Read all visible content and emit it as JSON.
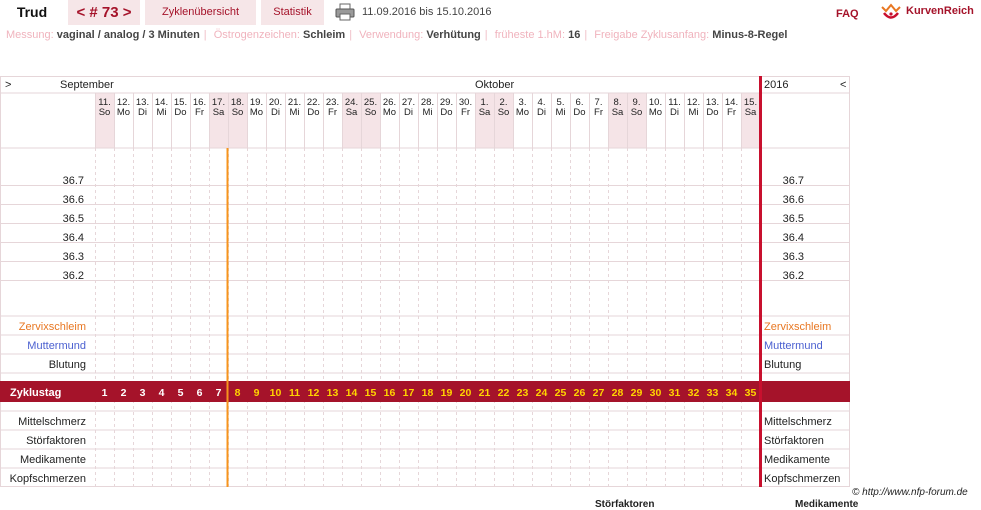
{
  "header": {
    "user": "Trud",
    "cycle_label": "< # 73 >",
    "tab_overview": "Zyklenübersicht",
    "tab_stats": "Statistik",
    "date_range": "11.09.2016 bis 15.10.2016",
    "faq": "FAQ",
    "logo": "KurvenReich"
  },
  "info": [
    {
      "key": "Messung:",
      "value": "vaginal / analog / 3 Minuten"
    },
    {
      "key": "Östrogenzeichen:",
      "value": "Schleim"
    },
    {
      "key": "Verwendung:",
      "value": "Verhütung"
    },
    {
      "key": "früheste 1.hM:",
      "value": "16"
    },
    {
      "key": "Freigabe Zyklusanfang:",
      "value": "Minus-8-Regel"
    }
  ],
  "chart_data": {
    "type": "table",
    "nav_prev": ">",
    "nav_next": "<",
    "year": "2016",
    "months": [
      {
        "label": "September",
        "start_index": 0
      },
      {
        "label": "Oktober",
        "start_index": 20
      }
    ],
    "days": [
      {
        "d": "11.",
        "w": "So"
      },
      {
        "d": "12.",
        "w": "Mo"
      },
      {
        "d": "13.",
        "w": "Di"
      },
      {
        "d": "14.",
        "w": "Mi"
      },
      {
        "d": "15.",
        "w": "Do"
      },
      {
        "d": "16.",
        "w": "Fr"
      },
      {
        "d": "17.",
        "w": "Sa"
      },
      {
        "d": "18.",
        "w": "So"
      },
      {
        "d": "19.",
        "w": "Mo"
      },
      {
        "d": "20.",
        "w": "Di"
      },
      {
        "d": "21.",
        "w": "Mi"
      },
      {
        "d": "22.",
        "w": "Do"
      },
      {
        "d": "23.",
        "w": "Fr"
      },
      {
        "d": "24.",
        "w": "Sa"
      },
      {
        "d": "25.",
        "w": "So"
      },
      {
        "d": "26.",
        "w": "Mo"
      },
      {
        "d": "27.",
        "w": "Di"
      },
      {
        "d": "28.",
        "w": "Mi"
      },
      {
        "d": "29.",
        "w": "Do"
      },
      {
        "d": "30.",
        "w": "Fr"
      },
      {
        "d": "1.",
        "w": "Sa"
      },
      {
        "d": "2.",
        "w": "So"
      },
      {
        "d": "3.",
        "w": "Mo"
      },
      {
        "d": "4.",
        "w": "Di"
      },
      {
        "d": "5.",
        "w": "Mi"
      },
      {
        "d": "6.",
        "w": "Do"
      },
      {
        "d": "7.",
        "w": "Fr"
      },
      {
        "d": "8.",
        "w": "Sa"
      },
      {
        "d": "9.",
        "w": "So"
      },
      {
        "d": "10.",
        "w": "Mo"
      },
      {
        "d": "11.",
        "w": "Di"
      },
      {
        "d": "12.",
        "w": "Mi"
      },
      {
        "d": "13.",
        "w": "Do"
      },
      {
        "d": "14.",
        "w": "Fr"
      },
      {
        "d": "15.",
        "w": "Sa"
      }
    ],
    "temperatures": [
      "36.7",
      "36.6",
      "36.5",
      "36.4",
      "36.3",
      "36.2"
    ],
    "rows_top": [
      {
        "label": "Zervixschleim",
        "color": "#e87722"
      },
      {
        "label": "Muttermund",
        "color": "#4a5fd0"
      },
      {
        "label": "Blutung",
        "color": "#222222"
      }
    ],
    "cycle_row_label": "Zyklustag",
    "cycle_days": [
      "1",
      "2",
      "3",
      "4",
      "5",
      "6",
      "7",
      "8",
      "9",
      "10",
      "11",
      "12",
      "13",
      "14",
      "15",
      "16",
      "17",
      "18",
      "19",
      "20",
      "21",
      "22",
      "23",
      "24",
      "25",
      "26",
      "27",
      "28",
      "29",
      "30",
      "31",
      "32",
      "33",
      "34",
      "35"
    ],
    "rows_bottom": [
      "Mittelschmerz",
      "Störfaktoren",
      "Medikamente",
      "Kopfschmerzen"
    ],
    "marker_after_day": 7,
    "today_index": 34,
    "colors": {
      "weekend": "#f5e4e7",
      "grid": "#e6d6d9",
      "cycle_band": "#a5132a",
      "cycle_day_pre": "#ffffff",
      "cycle_day_post": "#ffd400",
      "orange_line": "#f7941d",
      "red_line": "#c8102e"
    }
  },
  "footer": {
    "credit": "© http://www.nfp-forum.de",
    "cut_left": "Störfaktoren",
    "cut_right": "Medikamente"
  }
}
